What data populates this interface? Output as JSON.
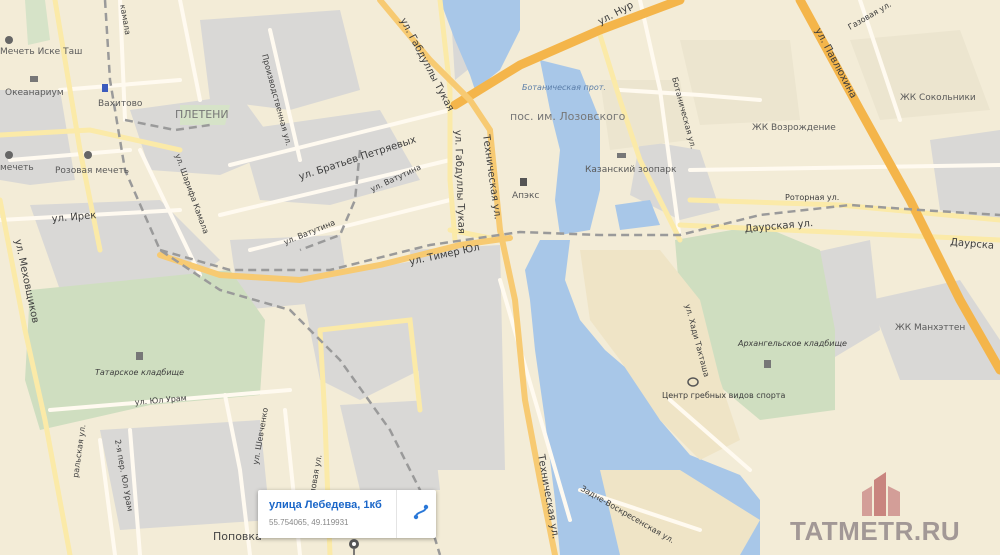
{
  "map": {
    "streets": {
      "gabdully_tukaya_north": "ул. Габдуллы Тукая",
      "gabdully_tukaya_south": "ул. Габдуллы Тукая",
      "tekhnicheskaya_north": "Техническая ул.",
      "tekhnicheskaya_south": "Техническая ул.",
      "bratyev_petryaevykh": "ул. Братьев Петряевых",
      "vatutina_1": "ул. Ватутина",
      "vatutina_2": "ул. Ватутина",
      "irek": "ул. Ирек",
      "sharifa_kamala": "ул. Шарифа Камала",
      "kamala": "камала",
      "meskovtsov": "ул. Меховщиков",
      "timer_yul": "ул. Тимер Юл",
      "yul_uram": "ул. Юл Урам",
      "shevchenko": "ул. Шевченко",
      "kholmovaya": "Холмовая ул.",
      "proizvodstvennaya": "Производственная ул.",
      "pavlyukhina": "ул. Павлюхина",
      "gazovaya": "Газовая ул.",
      "botanicheskaya": "Ботаническая ул.",
      "rotornaya": "Роторная ул.",
      "daurskaya": "Даурская ул.",
      "daurskaya_east": "Даурска",
      "khadi_taktasha": "ул. Хади Такташа",
      "zadne_voskresenskaya": "Задне-Воскресенская ул.",
      "nur": "ул. Нур",
      "yul_2nd": "2-я пер. Юл Урам",
      "yul_ural": "Юл Урам",
      "uralskaya": "ральская ул."
    },
    "places": {
      "mechet_iske_tash": "Мечеть Иске Таш",
      "okeanarium": "Океанариум",
      "vakhitovo": "Вахитово",
      "pletni": "ПЛЕТЕНИ",
      "rozovaya_mechet": "Розовая мечеть",
      "mechet": "мечеть",
      "apeks": "Апэкс",
      "botanicheskaya_prot": "Ботаническая прот.",
      "pos_lozovskogo": "пос. им. Лозовского",
      "kazansky_zoopark": "Казанский зоопарк",
      "zhk_vozrozhdenie": "ЖК Возрождение",
      "zhk_sokolniki": "ЖК Сокольники",
      "zhk_manhattan": "ЖК Манхэттен",
      "arkhangelskoe": "Архангельское кладбище",
      "tatarskoe": "Татарское кладбище",
      "tsentr_grebnykh": "Центр гребных видов спорта",
      "popovka": "Поповка"
    },
    "colors": {
      "land": "#f3ecd7",
      "water": "#a8c7e8",
      "road_major": "#f7be55",
      "road_minor": "#fff6d8",
      "industrial": "#d9d9d9",
      "green": "#cfdec0"
    }
  },
  "popup": {
    "title": "улица Лебедева, 1кб",
    "coords": "55.754065, 49.119931",
    "route_icon": "route-icon"
  },
  "watermark": {
    "text": "TATMETR.RU"
  }
}
